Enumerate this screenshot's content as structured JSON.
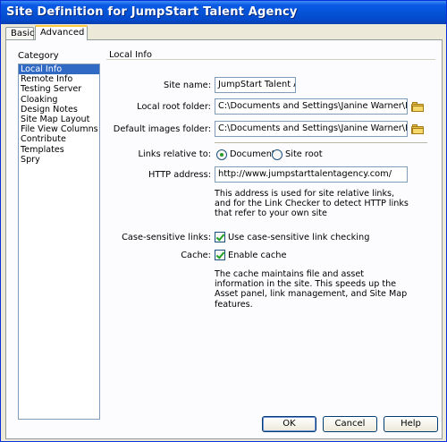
{
  "window": {
    "title": "Site Definition for JumpStart Talent Agency"
  },
  "tabs": [
    {
      "label": "Basic"
    },
    {
      "label": "Advanced"
    }
  ],
  "category": {
    "label": "Category",
    "items": [
      {
        "label": "Local Info",
        "selected": true
      },
      {
        "label": "Remote Info"
      },
      {
        "label": "Testing Server"
      },
      {
        "label": "Cloaking"
      },
      {
        "label": "Design Notes"
      },
      {
        "label": "Site Map Layout"
      },
      {
        "label": "File View Columns"
      },
      {
        "label": "Contribute"
      },
      {
        "label": "Templates"
      },
      {
        "label": "Spry"
      }
    ]
  },
  "local_info": {
    "title": "Local Info",
    "site_name_label": "Site name:",
    "site_name_value": "JumpStart Talent Ag",
    "root_folder_label": "Local root folder:",
    "root_folder_value": "C:\\Documents and Settings\\Janine Warner\\My Do",
    "images_folder_label": "Default images folder:",
    "images_folder_value": "C:\\Documents and Settings\\Janine Warner\\My Do",
    "links_label": "Links relative to:",
    "links_document": "Document",
    "links_site_root": "Site root",
    "http_label": "HTTP address:",
    "http_value": "http://www.jumpstarttalentagency.com/",
    "http_note": "This address is used for site relative links, and for the Link Checker to detect HTTP links that refer to your own site",
    "case_label": "Case-sensitive links:",
    "case_option": "Use case-sensitive link checking",
    "cache_label": "Cache:",
    "cache_option": "Enable cache",
    "cache_note": "The cache maintains file and asset information in the site.  This speeds up the Asset panel, link management, and Site Map features."
  },
  "buttons": {
    "ok": "OK",
    "cancel": "Cancel",
    "help": "Help"
  },
  "colors": {
    "title_bar": "#0553d6",
    "selection": "#316ac5",
    "check": "#21a121"
  }
}
